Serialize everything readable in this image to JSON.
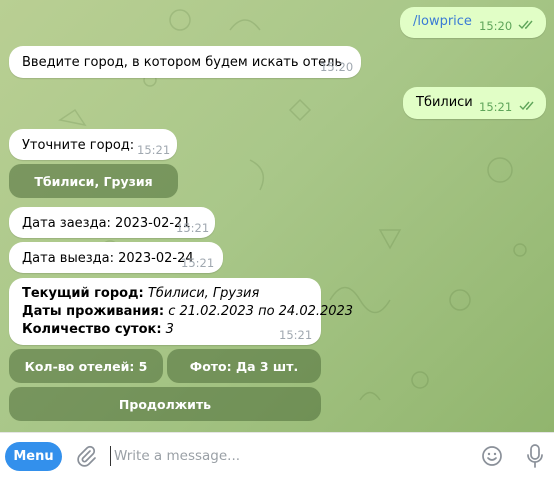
{
  "messages": {
    "lowprice": {
      "text": "/lowprice",
      "time": "15:20"
    },
    "enter_city": {
      "text": "Введите город, в котором будем искать отель",
      "time": "15:20"
    },
    "tbilisi": {
      "text": "Тбилиси",
      "time": "15:21"
    },
    "clarify": {
      "text": "Уточните город:",
      "time": "15:21"
    },
    "checkin": {
      "text": "Дата заезда: 2023-02-21",
      "time": "15:21"
    },
    "checkout": {
      "text": "Дата выезда: 2023-02-24",
      "time": "15:21"
    },
    "summary": {
      "city_label": "Текущий город:",
      "city_value": "Тбилиси, Грузия",
      "dates_label": "Даты проживания:",
      "dates_value": "с 21.02.2023 по 24.02.2023",
      "nights_label": "Количество суток:",
      "nights_value": "3",
      "time": "15:21"
    }
  },
  "keyboard": {
    "city_button": "Тбилиси, Грузия",
    "hotels_button": "Кол-во отелей: 5",
    "photos_button": "Фото: Да 3 шт.",
    "continue_button": "Продолжить"
  },
  "bottom_bar": {
    "menu_label": "Menu",
    "input_placeholder": "Write a message...",
    "input_value": ""
  },
  "colors": {
    "accent": "#3390ec",
    "outgoing_bubble": "#e1fec6",
    "incoming_bubble": "#ffffff",
    "read_ticks": "#5fa55a"
  },
  "icons": [
    "paperclip-icon",
    "emoji-icon",
    "microphone-icon",
    "double-check-icon"
  ]
}
